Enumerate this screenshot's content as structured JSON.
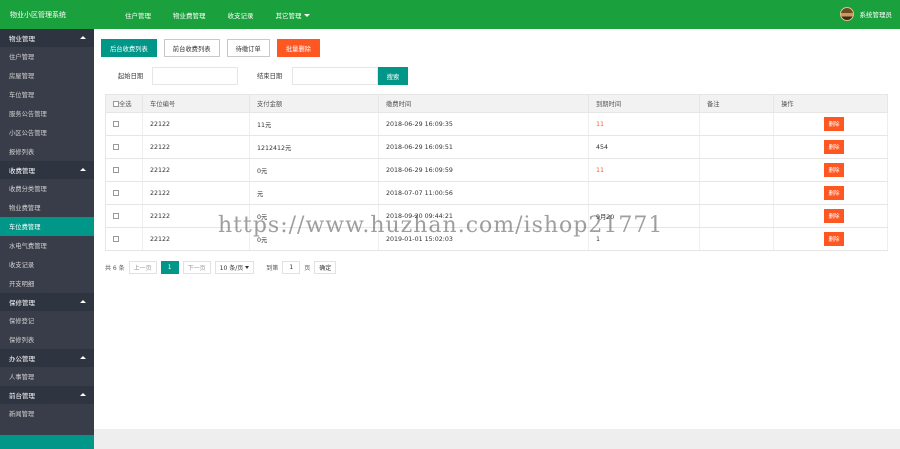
{
  "app": {
    "title": "物业小区管理系统",
    "user_name": "系统管理员"
  },
  "topnav": [
    {
      "label": "住户管理"
    },
    {
      "label": "物业费管理"
    },
    {
      "label": "收支记录"
    },
    {
      "label": "其它管理"
    }
  ],
  "sidebar": {
    "groups": [
      {
        "label": "物业管理",
        "items": [
          "住户管理",
          "房屋管理",
          "车位管理",
          "服务公告管理",
          "小区公告管理",
          "报修列表"
        ]
      },
      {
        "label": "收费管理",
        "items": [
          "收费分类管理",
          "物业费管理",
          "车位费管理",
          "水电气费管理",
          "收支记录",
          "开支明细"
        ]
      },
      {
        "label": "保修管理",
        "items": [
          "保修登记",
          "保修列表"
        ]
      },
      {
        "label": "办公管理",
        "items": [
          "人事管理"
        ]
      },
      {
        "label": "前台管理",
        "items": [
          "新闻管理"
        ]
      }
    ],
    "active_item": "车位费管理"
  },
  "toolbar": {
    "btn1": "后台收费列表",
    "btn2": "前台收费列表",
    "btn3": "待缴订单",
    "btn4": "批量删除"
  },
  "filter": {
    "start_label": "起始日期",
    "end_label": "结束日期",
    "search": "搜索"
  },
  "table": {
    "headers": [
      "全选",
      "车位编号",
      "支付金额",
      "缴费时间",
      "到期时间",
      "备注",
      "操作"
    ],
    "rows": [
      {
        "code": "22122",
        "amount": "11元",
        "paid": "2018-06-29 16:09:35",
        "due": "11",
        "due_red": true,
        "note": ""
      },
      {
        "code": "22122",
        "amount": "1212412元",
        "paid": "2018-06-29 16:09:51",
        "due": "454",
        "due_red": false,
        "note": ""
      },
      {
        "code": "22122",
        "amount": "0元",
        "paid": "2018-06-29 16:09:59",
        "due": "11",
        "due_red": true,
        "note": ""
      },
      {
        "code": "22122",
        "amount": "元",
        "paid": "2018-07-07 11:00:56",
        "due": "",
        "due_red": false,
        "note": ""
      },
      {
        "code": "22122",
        "amount": "0元",
        "paid": "2018-09-20 09:44:21",
        "due": "9月20",
        "due_red": false,
        "note": ""
      },
      {
        "code": "22122",
        "amount": "0元",
        "paid": "2019-01-01 15:02:03",
        "due": "1",
        "due_red": false,
        "note": ""
      }
    ],
    "delete_label": "删除"
  },
  "pager": {
    "total": "共 6 条",
    "prev": "上一页",
    "current": "1",
    "next": "下一页",
    "per_page": "10 条/页",
    "goto_label": "到第",
    "goto_value": "1",
    "page_unit": "页",
    "confirm": "确定"
  },
  "watermark": "https://www.huzhan.com/ishop21771",
  "colors": {
    "topbar": "#1aa03c",
    "sidebar": "#393d49",
    "accent": "#009688",
    "danger": "#ff5722"
  }
}
